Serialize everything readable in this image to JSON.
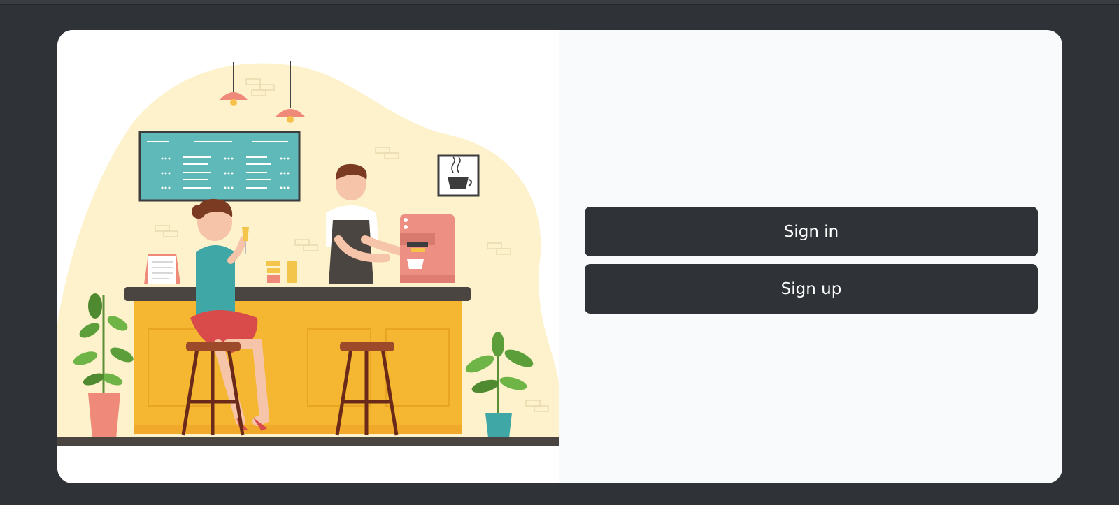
{
  "auth": {
    "sign_in_label": "Sign in",
    "sign_up_label": "Sign up"
  },
  "illustration": {
    "subject": "cafe-bar-scene",
    "icons": [
      "pendant-lamp-icon",
      "menu-board",
      "coffee-cup-frame",
      "coffee-machine",
      "plant-icon"
    ]
  },
  "colors": {
    "page_background": "#2f3338",
    "card_background": "#f9fafb",
    "button_background": "#2f3338",
    "button_text": "#ffffff",
    "counter": "#f5b731",
    "menu_board": "#5fb9b9"
  }
}
